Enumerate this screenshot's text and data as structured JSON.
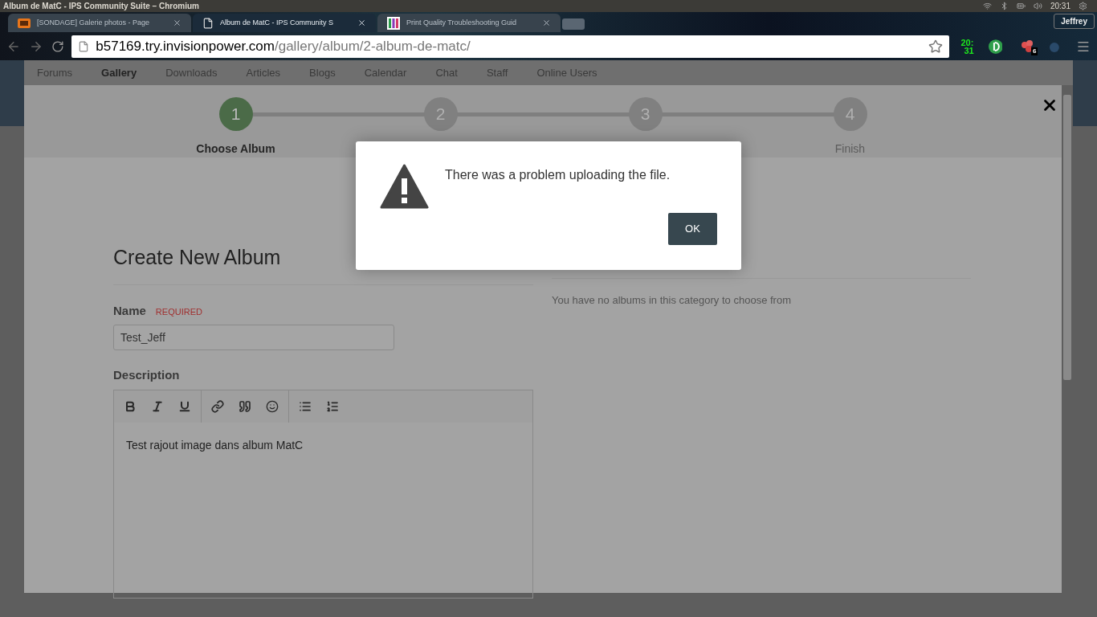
{
  "window": {
    "title": "Album de MatC - IPS Community Suite – Chromium",
    "clock": "20:31",
    "user": "Jeffrey"
  },
  "tabs": [
    {
      "label": "[SONDAGE] Galerie photos - Page",
      "kind": "logo",
      "selected": false
    },
    {
      "label": "Album de MatC - IPS Community S",
      "kind": "page",
      "selected": true
    },
    {
      "label": "Print Quality Troubleshooting Guid",
      "kind": "bars",
      "selected": false
    }
  ],
  "address_bar": {
    "host": "b57169.try.invisionpower.com",
    "path": "/gallery/album/2-album-de-matc/"
  },
  "extensions": {
    "clock_hours": "20:",
    "clock_minutes": "31",
    "badge": "6"
  },
  "nav": [
    {
      "label": "Forums",
      "selected": false
    },
    {
      "label": "Gallery",
      "selected": true
    },
    {
      "label": "Downloads",
      "selected": false
    },
    {
      "label": "Articles",
      "selected": false
    },
    {
      "label": "Blogs",
      "selected": false
    },
    {
      "label": "Calendar",
      "selected": false
    },
    {
      "label": "Chat",
      "selected": false
    },
    {
      "label": "Staff",
      "selected": false
    },
    {
      "label": "Online Users",
      "selected": false
    }
  ],
  "wizard": [
    {
      "number": "1",
      "label": "Choose Album",
      "selected": true
    },
    {
      "number": "2",
      "selected": false
    },
    {
      "number": "3",
      "selected": false
    },
    {
      "number": "4",
      "label": "Finish",
      "selected": false
    }
  ],
  "create_album": {
    "title": "Create New Album",
    "name_label": "Name",
    "required": "REQUIRED",
    "name_value": "Test_Jeff",
    "description_label": "Description",
    "description_text": "Test rajout image dans album MatC"
  },
  "existing_album": {
    "empty": "You have no albums in this category to choose from"
  },
  "dialog": {
    "message": "There was a problem uploading the file.",
    "button": "OK"
  }
}
